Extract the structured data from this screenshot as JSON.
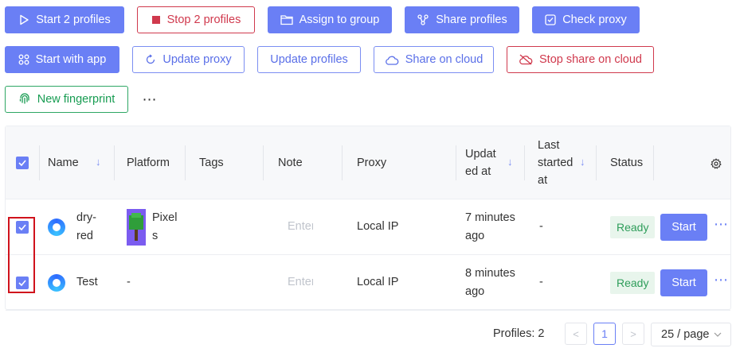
{
  "toolbar": {
    "start_profiles": "Start 2 profiles",
    "stop_profiles": "Stop 2 profiles",
    "assign_group": "Assign to group",
    "share_profiles": "Share profiles",
    "check_proxy": "Check proxy",
    "start_with_app": "Start with app",
    "update_proxy": "Update proxy",
    "update_profiles": "Update profiles",
    "share_on_cloud": "Share on cloud",
    "stop_share_on_cloud": "Stop share on cloud",
    "new_fingerprint": "New fingerprint",
    "more": "⋯"
  },
  "table": {
    "columns": {
      "name": "Name",
      "platform": "Platform",
      "tags": "Tags",
      "note": "Note",
      "proxy": "Proxy",
      "updated_at_1": "Updat",
      "updated_at_2": "ed at",
      "last_started_1": "Last",
      "last_started_2": "started",
      "last_started_3": "at",
      "status": "Status"
    },
    "rows": [
      {
        "name_1": "dry-",
        "name_2": "red",
        "platform_1": "Pixel",
        "platform_2": "s",
        "note_placeholder": "Enter",
        "proxy": "Local IP",
        "updated_1": "7 minutes",
        "updated_2": "ago",
        "last_started": "-",
        "status": "Ready",
        "action": "Start",
        "more": "⋯"
      },
      {
        "name": "Test",
        "platform": "-",
        "note_placeholder": "Enter",
        "proxy": "Local IP",
        "updated_1": "8 minutes",
        "updated_2": "ago",
        "last_started": "-",
        "status": "Ready",
        "action": "Start",
        "more": "⋯"
      }
    ]
  },
  "pagination": {
    "count_label": "Profiles: 2",
    "current_page": "1",
    "page_size": "25 / page",
    "prev": "<",
    "next": ">"
  },
  "colors": {
    "primary": "#6a7ff5",
    "danger": "#d0394d",
    "success": "#179c52",
    "highlight": "#d0121c"
  }
}
